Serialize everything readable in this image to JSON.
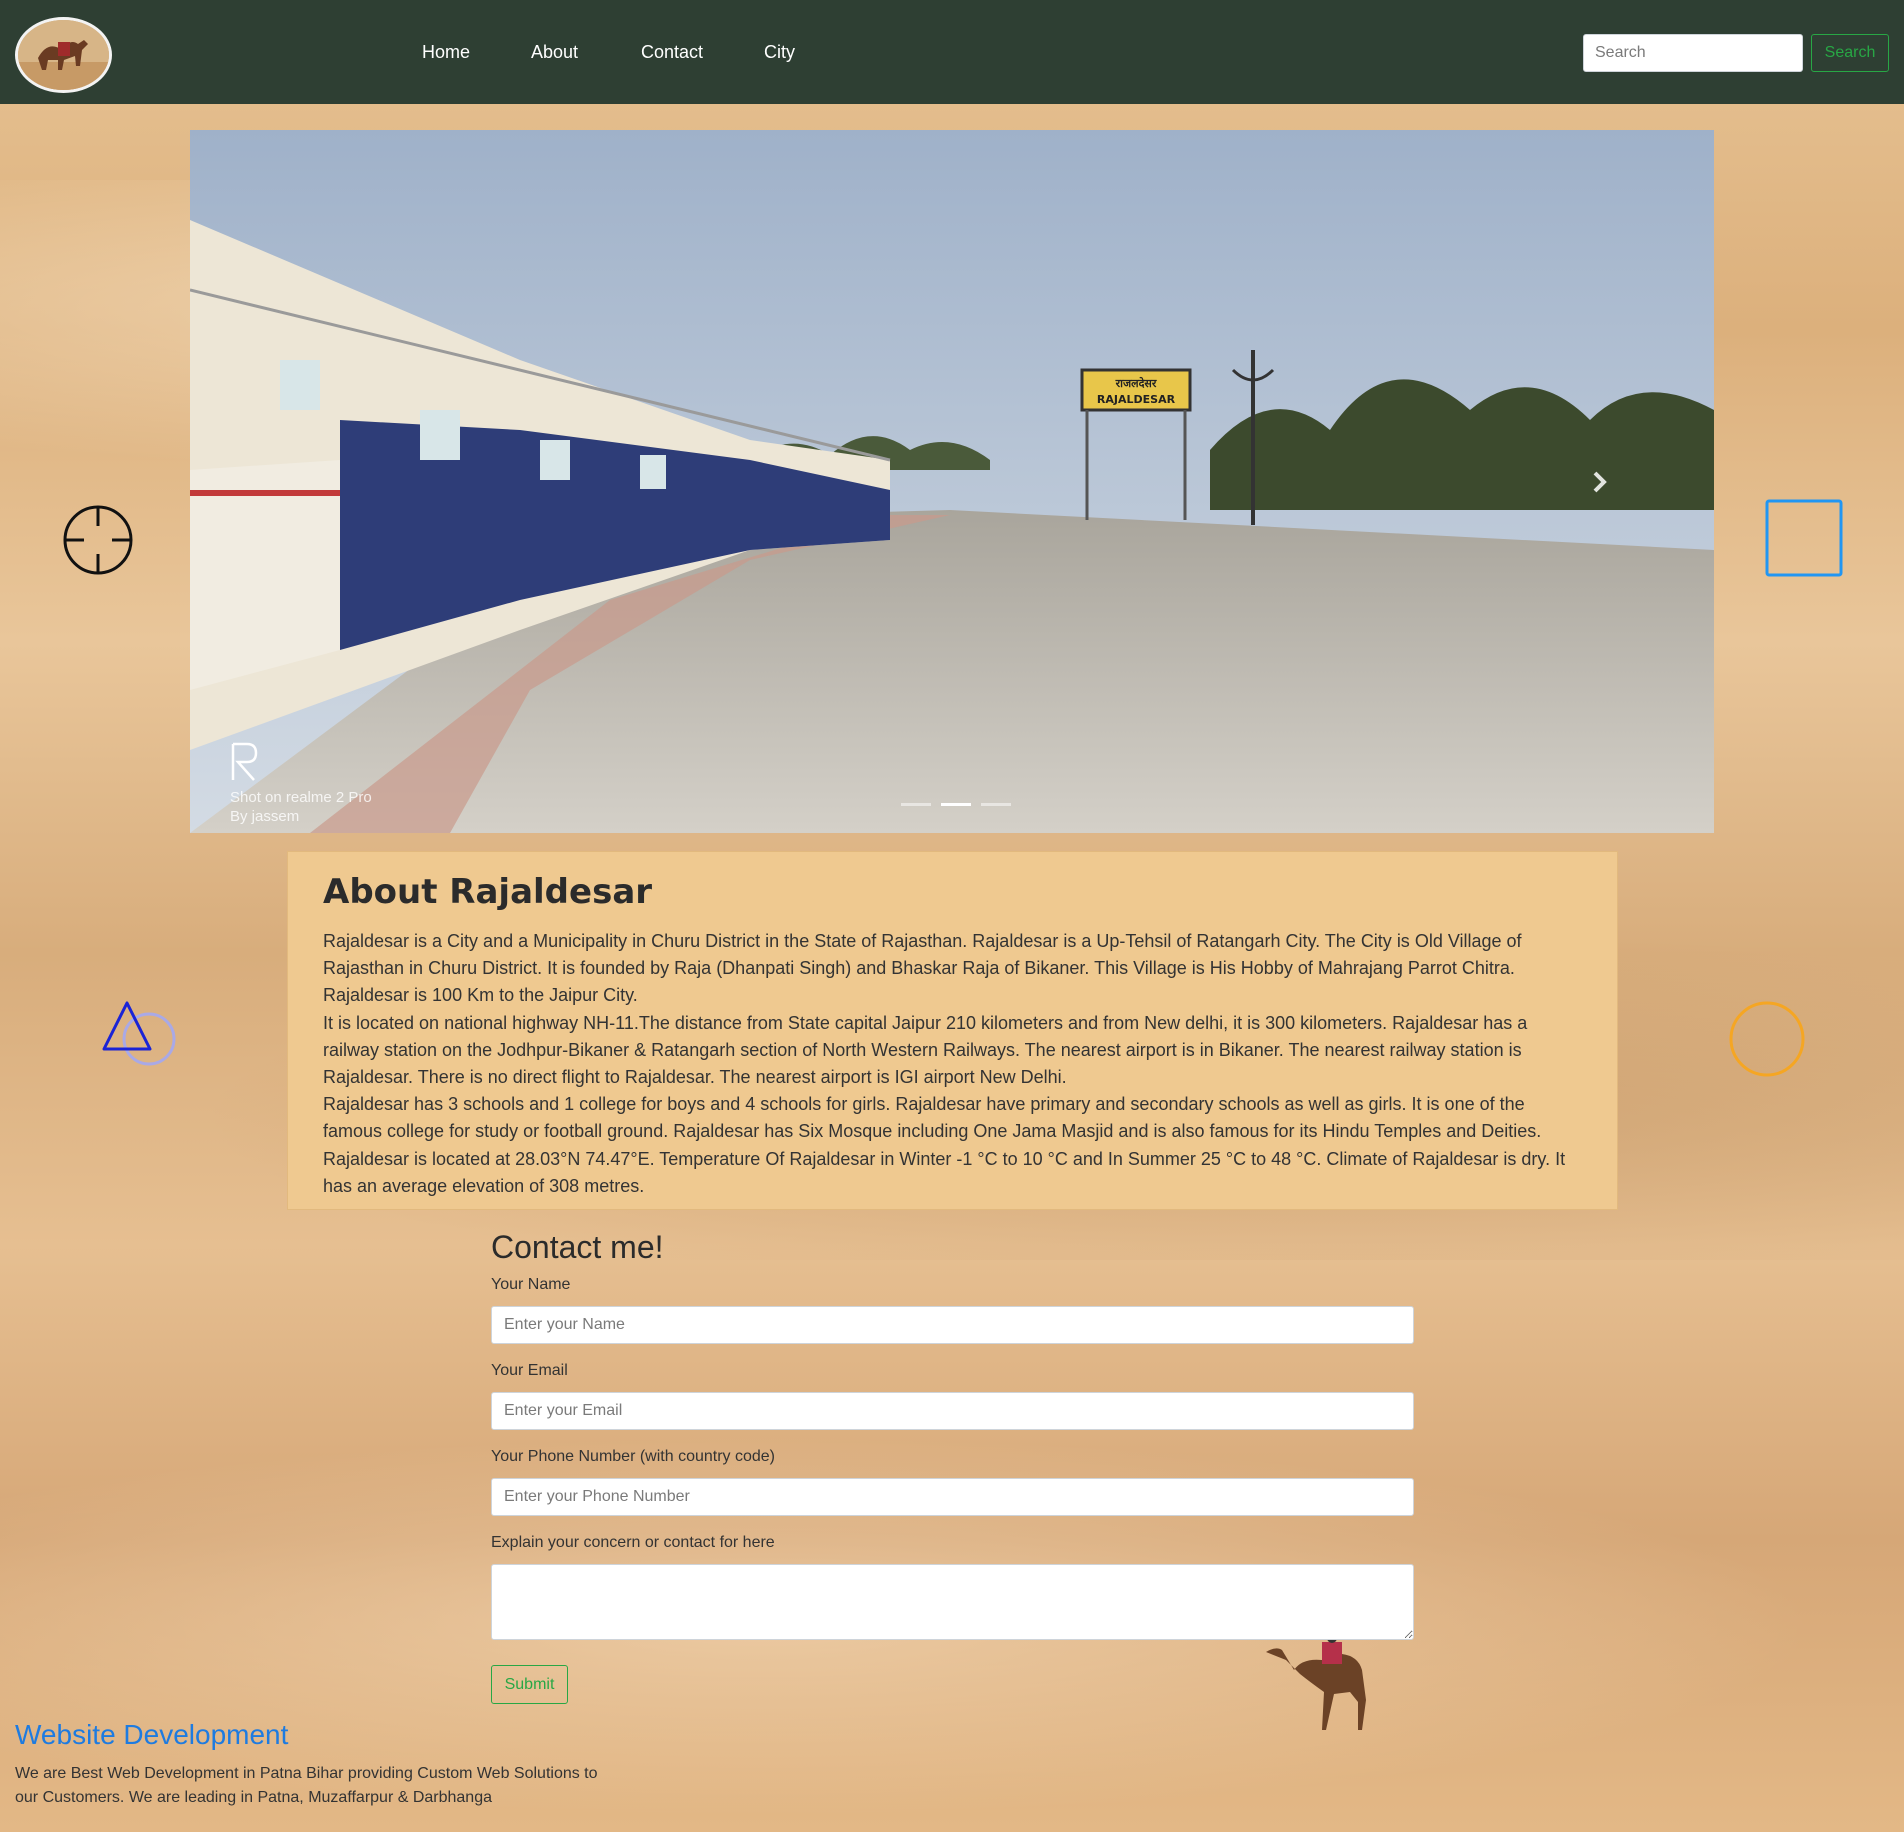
{
  "colors": {
    "navbar_bg": "#2e3f33",
    "success_green": "#28a745",
    "link_blue": "#1e7be0",
    "about_bg": "#efc990",
    "target_icon": "#111111",
    "square_icon": "#2196f3",
    "triangle_icon": "#1a23d6",
    "circle_small_icon": "#a9a9e6",
    "circle_large_icon": "#f5a623"
  },
  "navbar": {
    "logo_icon": "camel-logo",
    "links": [
      "Home",
      "About",
      "Contact",
      "City"
    ],
    "search": {
      "placeholder": "Search",
      "button_label": "Search"
    }
  },
  "carousel": {
    "icon": "train-station-photo",
    "station_sign": "राजलदेसर RAJALDESAR",
    "watermark_line1": "Shot on realme 2 Pro",
    "watermark_line2": "By jassem",
    "indicators": 3,
    "active_indicator": 2,
    "next_icon": "chevron-right-icon"
  },
  "about": {
    "title": "About Rajaldesar",
    "paragraphs": [
      "Rajaldesar is a City and a Municipality in Churu District in the State of Rajasthan. Rajaldesar is a Up-Tehsil of Ratangarh City. The City is Old Village of Rajasthan in Churu District. It is founded by Raja (Dhanpati Singh) and Bhaskar Raja of Bikaner. This Village is His Hobby of Mahrajang Parrot Chitra. Rajaldesar is 100 Km to the Jaipur City.",
      "It is located on national highway NH-11.The distance from State capital Jaipur 210 kilometers and from New delhi, it is 300 kilometers. Rajaldesar has a railway station on the Jodhpur-Bikaner & Ratangarh section of North Western Railways. The nearest airport is in Bikaner. The nearest railway station is Rajaldesar. There is no direct flight to Rajaldesar. The nearest airport is IGI airport New Delhi.",
      "Rajaldesar has 3 schools and 1 college for boys and 4 schools for girls. Rajaldesar have primary and secondary schools as well as girls. It is one of the famous college for study or football ground. Rajaldesar has Six Mosque including One Jama Masjid and is also famous for its Hindu Temples and Deities.",
      "Rajaldesar is located at 28.03°N 74.47°E. Temperature Of Rajaldesar in Winter -1 °C to 10 °C and In Summer 25 °C to 48 °C. Climate of Rajaldesar is dry. It has an average elevation of 308 metres."
    ]
  },
  "contact": {
    "title": "Contact me!",
    "name_label": "Your Name",
    "name_placeholder": "Enter your Name",
    "email_label": "Your Email",
    "email_placeholder": "Enter your Email",
    "phone_label": "Your Phone Number (with country code)",
    "phone_placeholder": "Enter your Phone Number",
    "message_label": "Explain your concern or contact for here",
    "submit_label": "Submit"
  },
  "footer": {
    "title": "Website Development",
    "text": "We are Best Web Development in Patna Bihar providing Custom Web Solutions to our Customers. We are leading in Patna, Muzaffarpur & Darbhanga"
  }
}
